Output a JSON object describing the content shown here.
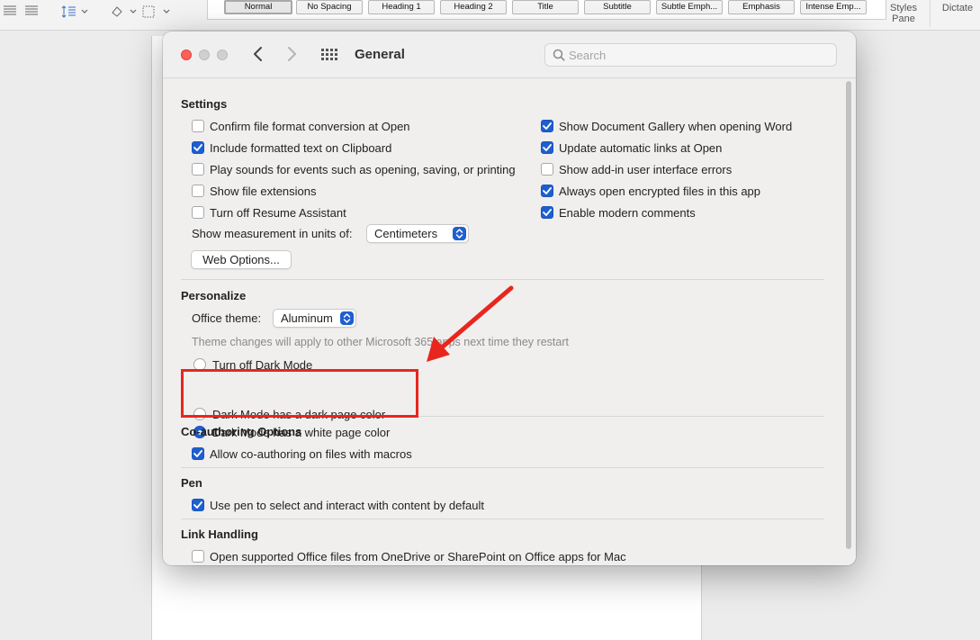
{
  "ribbon": {
    "styles": [
      {
        "label": "Normal",
        "selected": true
      },
      {
        "label": "No Spacing",
        "selected": false
      },
      {
        "label": "Heading 1",
        "selected": false
      },
      {
        "label": "Heading 2",
        "selected": false
      },
      {
        "label": "Title",
        "selected": false
      },
      {
        "label": "Subtitle",
        "selected": false
      },
      {
        "label": "Subtle Emph...",
        "selected": false
      },
      {
        "label": "Emphasis",
        "selected": false
      },
      {
        "label": "Intense Emp...",
        "selected": false
      }
    ],
    "styles_pane_line1": "Styles",
    "styles_pane_line2": "Pane",
    "dictate": "Dictate"
  },
  "dialog": {
    "title": "General",
    "search_placeholder": "Search"
  },
  "settings": {
    "title": "Settings",
    "left": [
      {
        "label": "Confirm file format conversion at Open",
        "checked": false
      },
      {
        "label": "Include formatted text on Clipboard",
        "checked": true
      },
      {
        "label": "Play sounds for events such as opening, saving, or printing",
        "checked": false
      },
      {
        "label": "Show file extensions",
        "checked": false
      },
      {
        "label": "Turn off Resume Assistant",
        "checked": false
      }
    ],
    "right": [
      {
        "label": "Show Document Gallery when opening Word",
        "checked": true
      },
      {
        "label": "Update automatic links at Open",
        "checked": true
      },
      {
        "label": "Show add-in user interface errors",
        "checked": false
      },
      {
        "label": "Always open encrypted files in this app",
        "checked": true
      },
      {
        "label": "Enable modern comments",
        "checked": true
      }
    ],
    "measurement_label": "Show measurement in units of:",
    "measurement_value": "Centimeters",
    "web_options": "Web Options..."
  },
  "personalize": {
    "title": "Personalize",
    "theme_label": "Office theme:",
    "theme_value": "Aluminum",
    "hint": "Theme changes will apply to other Microsoft 365 apps next time they restart",
    "radios": [
      {
        "label": "Turn off Dark Mode",
        "selected": false
      },
      {
        "label": "Dark Mode has a dark page color",
        "selected": false
      },
      {
        "label": "Dark Mode has a white page color",
        "selected": true
      }
    ]
  },
  "coauthoring": {
    "title": "Co-authoring Options",
    "items": [
      {
        "label": "Allow co-authoring on files with macros",
        "checked": true
      }
    ]
  },
  "pen": {
    "title": "Pen",
    "items": [
      {
        "label": "Use pen to select and interact with content by default",
        "checked": true
      }
    ]
  },
  "link_handling": {
    "title": "Link Handling",
    "items": [
      {
        "label": "Open supported Office files from OneDrive or SharePoint on Office apps for Mac",
        "checked": false
      }
    ]
  },
  "colors": {
    "accent": "#1e5fcf",
    "annotation": "#e8261d"
  }
}
